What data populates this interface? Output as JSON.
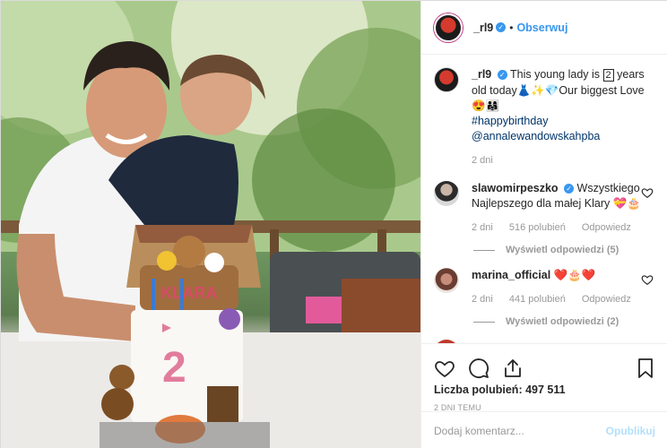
{
  "header": {
    "username": "_rl9",
    "verified_icon": "verified-badge-icon",
    "separator": "•",
    "follow_label": "Obserwuj"
  },
  "caption": {
    "username": "_rl9",
    "text_1": "This young lady is ",
    "number_box": "2",
    "text_2": " years old today👗✨💎Our biggest Love😍👨‍👩‍👧",
    "hashtag": "#happybirthday",
    "mention": "@annalewandowskahpba",
    "time": "2 dni"
  },
  "comments": [
    {
      "username": "slawomirpeszko",
      "text": "Wszystkiego Najlepszego dla małej Klary 💝🎂",
      "time": "2 dni",
      "likes": "516 polubień",
      "reply": "Odpowiedz",
      "view_replies": "Wyświetl odpowiedzi (5)"
    },
    {
      "username": "marina_official",
      "text": "❤️🎂❤️",
      "time": "2 dni",
      "likes": "441 polubień",
      "reply": "Odpowiedz",
      "view_replies": "Wyświetl odpowiedzi (2)"
    }
  ],
  "actions": {
    "like_icon": "heart-icon",
    "comment_icon": "comment-icon",
    "share_icon": "share-icon",
    "save_icon": "bookmark-icon",
    "likes_text": "Liczba polubień: 497 511",
    "posted_ago": "2 DNI TEMU"
  },
  "add_comment": {
    "placeholder": "Dodaj komentarz...",
    "post_label": "Opublikuj"
  },
  "photo": {
    "cake_text": "KLARA",
    "cake_number": "2"
  },
  "colors": {
    "accent": "#3897f0",
    "verified": "#3897f0",
    "muted": "#999999",
    "post_disabled": "#b2dffc"
  }
}
